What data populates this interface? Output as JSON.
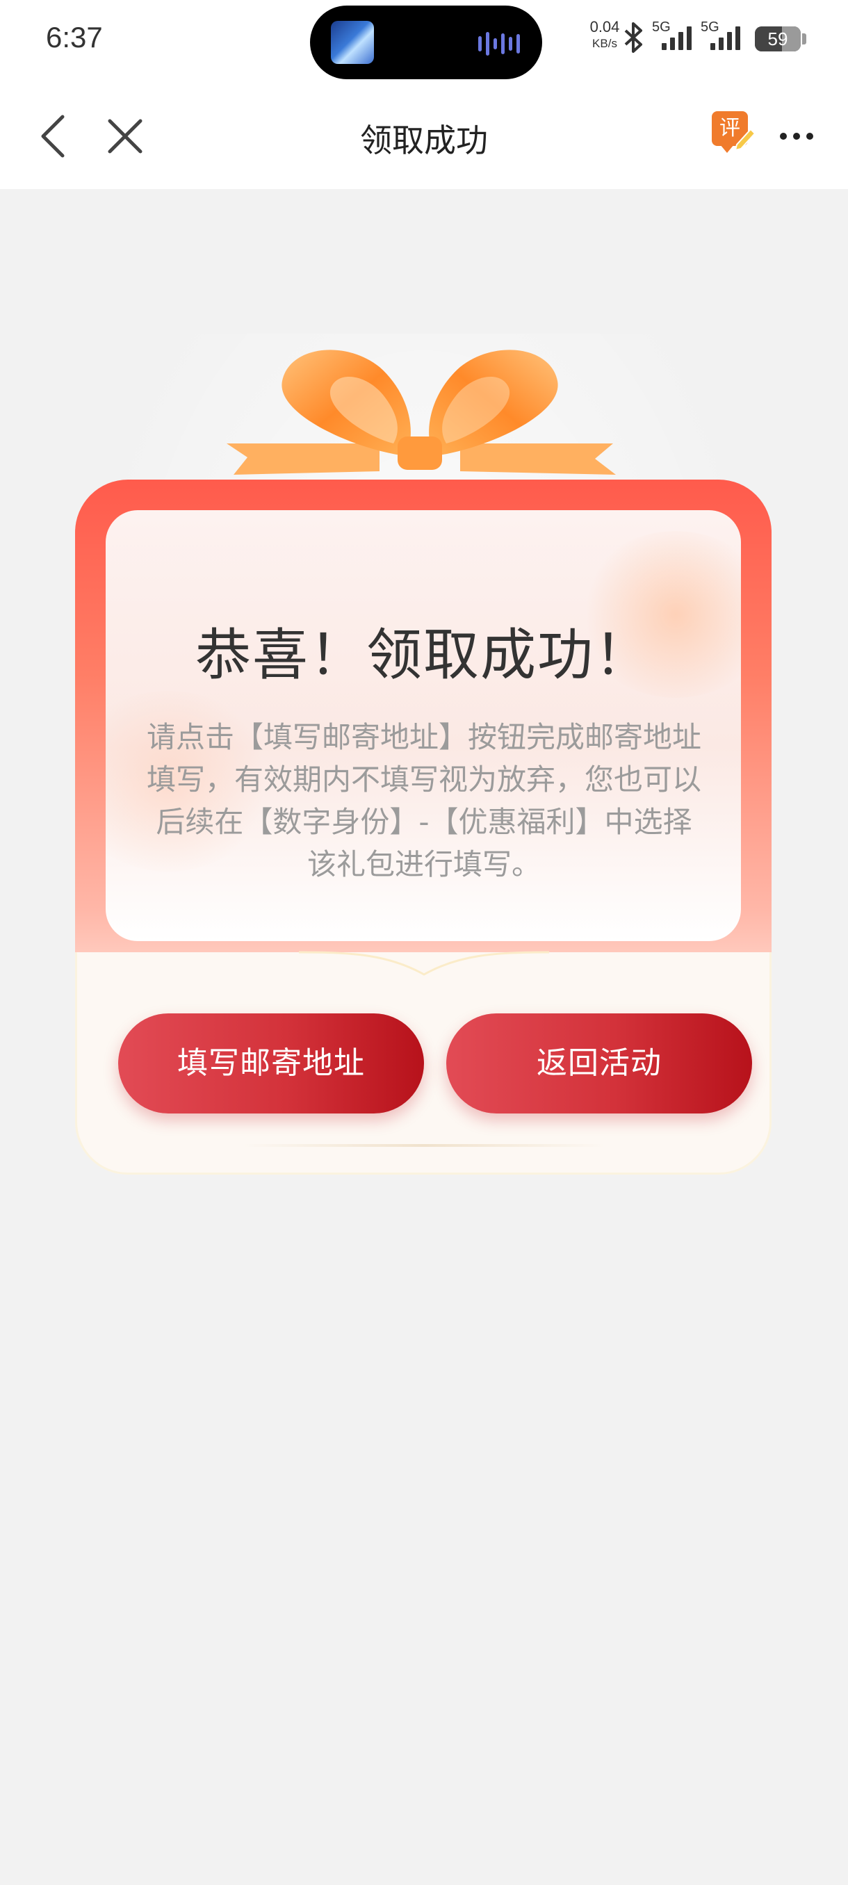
{
  "status_bar": {
    "time": "6:37",
    "net_speed_value": "0.04",
    "net_speed_unit": "KB/s",
    "signal_1": "5G",
    "signal_2": "5G",
    "battery": "59"
  },
  "nav": {
    "title": "领取成功",
    "review_label": "评"
  },
  "card": {
    "title": "恭喜！领取成功！",
    "description": "请点击【填写邮寄地址】按钮完成邮寄地址填写，有效期内不填写视为放弃，您也可以后续在【数字身份】-【优惠福利】中选择该礼包进行填写。",
    "fill_address_button": "填写邮寄地址",
    "back_button": "返回活动"
  },
  "colors": {
    "accent_red": "#d3323a",
    "ribbon_orange": "#ff9a3d",
    "card_red": "#ff5b4c",
    "page_bg": "#f2f2f2"
  }
}
